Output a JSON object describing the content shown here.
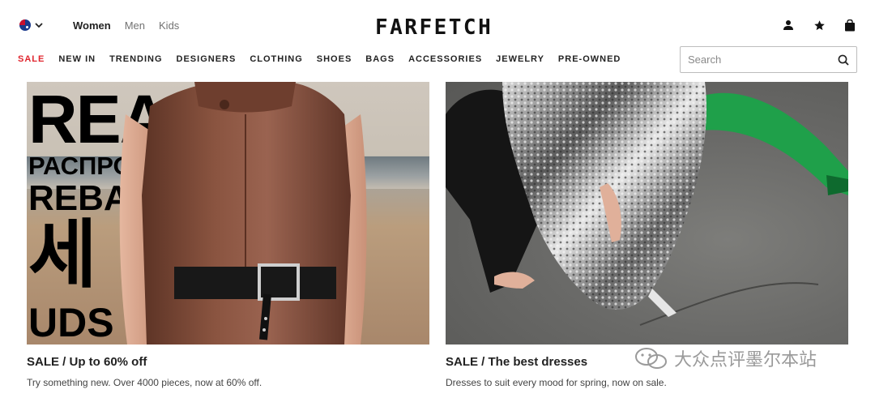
{
  "header": {
    "region_icon": "australia-flag-icon",
    "gender_tabs": [
      {
        "label": "Women",
        "active": true
      },
      {
        "label": "Men",
        "active": false
      },
      {
        "label": "Kids",
        "active": false
      }
    ],
    "logo": "FARFETCH",
    "icons": [
      "account-icon",
      "wishlist-star-icon",
      "shopping-bag-icon"
    ]
  },
  "nav": {
    "categories": [
      {
        "label": "SALE",
        "highlight": true
      },
      {
        "label": "NEW IN"
      },
      {
        "label": "TRENDING"
      },
      {
        "label": "DESIGNERS"
      },
      {
        "label": "CLOTHING"
      },
      {
        "label": "SHOES"
      },
      {
        "label": "BAGS"
      },
      {
        "label": "ACCESSORIES"
      },
      {
        "label": "JEWELRY"
      },
      {
        "label": "PRE-OWNED"
      }
    ]
  },
  "search": {
    "placeholder": "Search",
    "value": ""
  },
  "banners": [
    {
      "title": "SALE / Up to 60% off",
      "description": "Try something new. Over 4000 pieces, now at 60% off.",
      "poster_lines": [
        "REA",
        "РАСПРО",
        "REBA",
        "세",
        "UDS"
      ]
    },
    {
      "title": "SALE / The best dresses",
      "description": "Dresses to suit every mood for spring, now on sale."
    }
  ],
  "watermark": "大众点评墨尔本站",
  "colors": {
    "sale": "#e0252e",
    "text": "#222222",
    "muted": "#727272"
  }
}
